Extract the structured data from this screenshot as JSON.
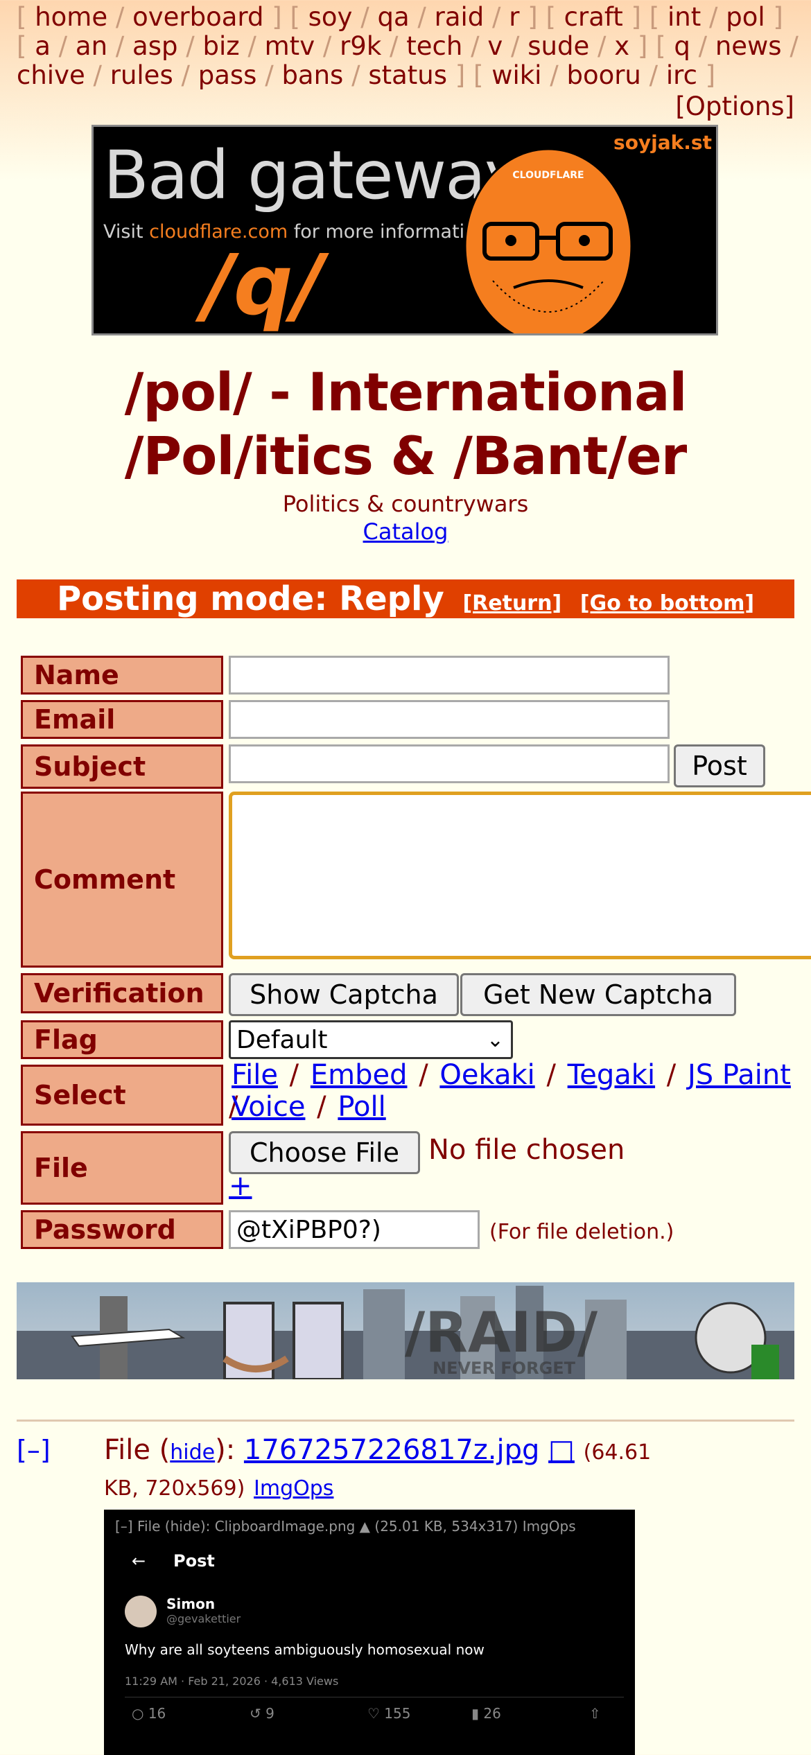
{
  "nav": {
    "groups": [
      [
        "home",
        "overboard"
      ],
      [
        "soy",
        "qa",
        "raid",
        "r"
      ],
      [
        "craft"
      ],
      [
        "int",
        "pol"
      ],
      [
        "a",
        "an",
        "asp",
        "biz",
        "mtv",
        "r9k",
        "tech",
        "v",
        "sude",
        "x"
      ],
      [
        "q",
        "news",
        "chive",
        "rules",
        "pass",
        "bans",
        "status"
      ],
      [
        "wiki",
        "booru",
        "irc"
      ]
    ],
    "options": "[Options]"
  },
  "banner": {
    "title": "Bad gateway",
    "visit_prefix": "Visit ",
    "visit_link": "cloudflare.com",
    "visit_suffix": " for more information.",
    "board": "/q/",
    "site": "soyjak.st",
    "badge": "CLOUDFLARE"
  },
  "board": {
    "title": "/pol/ - International /Pol/itics & /Bant/er",
    "subtitle": "Politics & countrywars",
    "catalog": "Catalog"
  },
  "posting_mode": {
    "label": "Posting mode: Reply",
    "return": "[Return]",
    "bottom": "[Go to bottom]"
  },
  "form": {
    "name_label": "Name",
    "email_label": "Email",
    "subject_label": "Subject",
    "post_button": "Post",
    "comment_label": "Comment",
    "verification_label": "Verification",
    "show_captcha": "Show Captcha",
    "new_captcha": "Get New Captcha",
    "flag_label": "Flag",
    "flag_value": "Default",
    "select_label": "Select",
    "select_options": [
      "File",
      "Embed",
      "Oekaki",
      "Tegaki",
      "JS Paint",
      "Voice",
      "Poll"
    ],
    "file_label": "File",
    "choose_file": "Choose File",
    "no_file": "No file chosen",
    "plus": "+",
    "password_label": "Password",
    "password_value": "@tXiPBP0?)",
    "password_note": "(For file deletion.)"
  },
  "raid_banner": {
    "text": "/RAID/",
    "subtext": "NEVER FORGET"
  },
  "post": {
    "toggle": "[–]",
    "file_prefix": "File (",
    "hide": "hide",
    "file_mid": "): ",
    "filename": "1767257226817z.jpg",
    "icon": "□",
    "size": "(64.61 KB, 720x569)",
    "imgops": "ImgOps",
    "thumb": {
      "header": "[–] File (hide): ClipboardImage.png ▲ (25.01 KB, 534x317) ImgOps",
      "back": "←",
      "title": "Post",
      "user": "Simon",
      "handle": "@gevakettier",
      "text": "Why are all soyteens ambiguously homosexual now",
      "time": "11:29 AM · Feb 21, 2026 · 4,613 Views",
      "replies": "16",
      "reposts": "9",
      "likes": "155",
      "bookmarks": "26"
    }
  }
}
